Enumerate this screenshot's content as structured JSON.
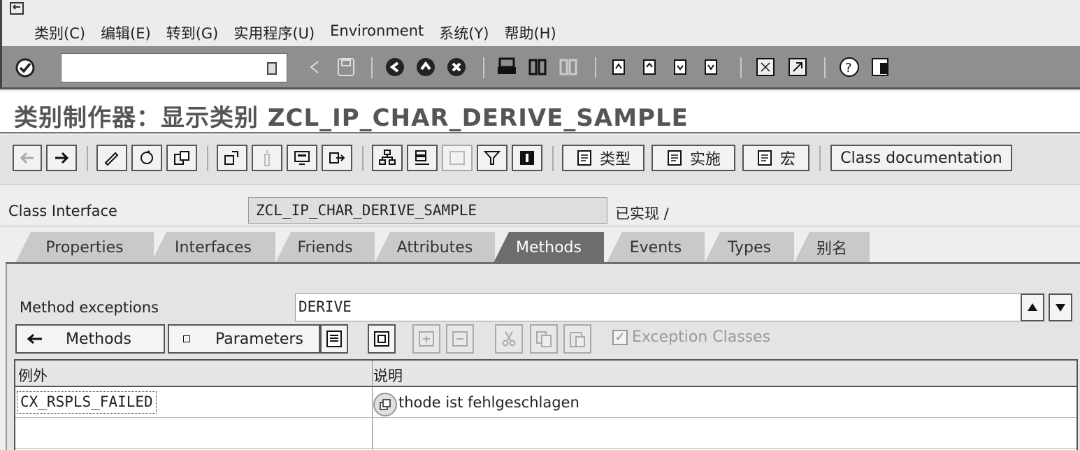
{
  "menu": {
    "items": [
      "类别(C)",
      "编辑(E)",
      "转到(G)",
      "实用程序(U)",
      "Environment",
      "系统(Y)",
      "帮助(H)"
    ]
  },
  "system_toolbar": {
    "command_field_value": "",
    "icons": [
      "enter-icon",
      "back-icon",
      "save-icon",
      "green-back-icon",
      "exit-icon",
      "cancel-icon",
      "print-icon",
      "find-icon",
      "find-next-icon",
      "first-page-icon",
      "prev-page-icon",
      "next-page-icon",
      "last-page-icon",
      "new-session-icon",
      "shortcut-icon",
      "help-icon",
      "layout-menu-icon"
    ]
  },
  "title": "类别制作器：显示类别 ZCL_IP_CHAR_DERIVE_SAMPLE",
  "app_toolbar": {
    "type_label": "类型",
    "impl_label": "实施",
    "macro_label": "宏",
    "doc_label": "Class documentation"
  },
  "class_field": {
    "label": "Class Interface",
    "value": "ZCL_IP_CHAR_DERIVE_SAMPLE",
    "status": "已实现 /"
  },
  "tabs": [
    "Properties",
    "Interfaces",
    "Friends",
    "Attributes",
    "Methods",
    "Events",
    "Types",
    "别名"
  ],
  "active_tab": "Methods",
  "method_exceptions": {
    "label": "Method exceptions",
    "value": "DERIVE"
  },
  "sub_toolbar": {
    "methods_label": "Methods",
    "parameters_label": "Parameters",
    "exception_classes_label": "Exception Classes",
    "exception_classes_checked": true
  },
  "grid": {
    "columns": [
      "例外",
      "说明"
    ],
    "rows": [
      {
        "exception": "CX_RSPLS_FAILED",
        "description": "thode ist fehlgeschlagen"
      }
    ]
  }
}
